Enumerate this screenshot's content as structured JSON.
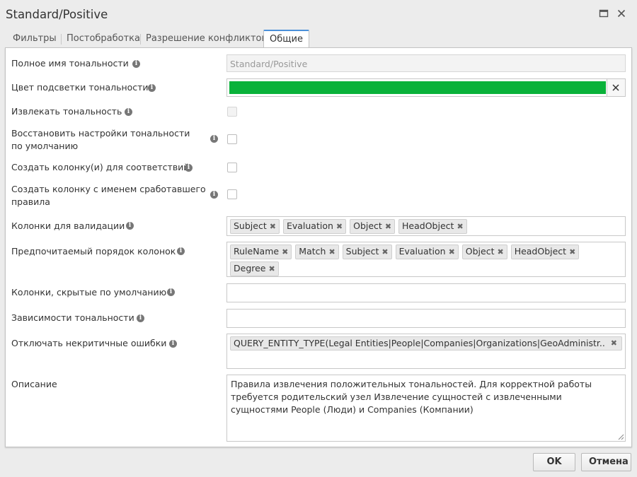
{
  "window": {
    "title": "Standard/Positive",
    "maximize_icon": "maximize-icon",
    "close_icon": "close-icon"
  },
  "tabs": [
    {
      "label": "Фильтры",
      "active": false
    },
    {
      "label": "Постобработка",
      "active": false
    },
    {
      "label": "Разрешение конфликтов",
      "active": false
    },
    {
      "label": "Общие",
      "active": true
    }
  ],
  "form": {
    "full_name": {
      "label": "Полное имя тональности",
      "value": "Standard/Positive"
    },
    "color": {
      "label": "Цвет подсветки тональности",
      "value": "#0ab23a"
    },
    "extract": {
      "label": "Извлекать тональность",
      "checked": false
    },
    "restore_defaults": {
      "label": "Восстановить настройки тональности по умолчанию",
      "checked": false
    },
    "create_columns": {
      "label": "Создать колонку(и) для соответствий",
      "checked": false
    },
    "create_rule_column": {
      "label": "Создать колонку с именем сработавшего правила",
      "checked": false
    },
    "validation_columns": {
      "label": "Колонки для валидации",
      "tags": [
        "Subject",
        "Evaluation",
        "Object",
        "HeadObject"
      ]
    },
    "preferred_order": {
      "label": "Предпочитаемый порядок колонок",
      "tags": [
        "RuleName",
        "Match",
        "Subject",
        "Evaluation",
        "Object",
        "HeadObject",
        "Degree"
      ]
    },
    "hidden_columns": {
      "label": "Колонки, скрытые по умолчанию",
      "value": ""
    },
    "dependencies": {
      "label": "Зависимости тональности",
      "value": ""
    },
    "disable_errors": {
      "label": "Отключать некритичные ошибки",
      "tags": [
        "QUERY_ENTITY_TYPE(Legal Entities|People|Companies|Organizations|GeoAdministr..."
      ]
    },
    "description": {
      "label": "Описание",
      "value": "Правила извлечения положительных тональностей. Для корректной работы требуется родительский узел Извлечение сущностей с извлеченными сущностями People (Люди) и Companies (Компании)"
    }
  },
  "buttons": {
    "ok": "OK",
    "cancel": "Отмена"
  }
}
